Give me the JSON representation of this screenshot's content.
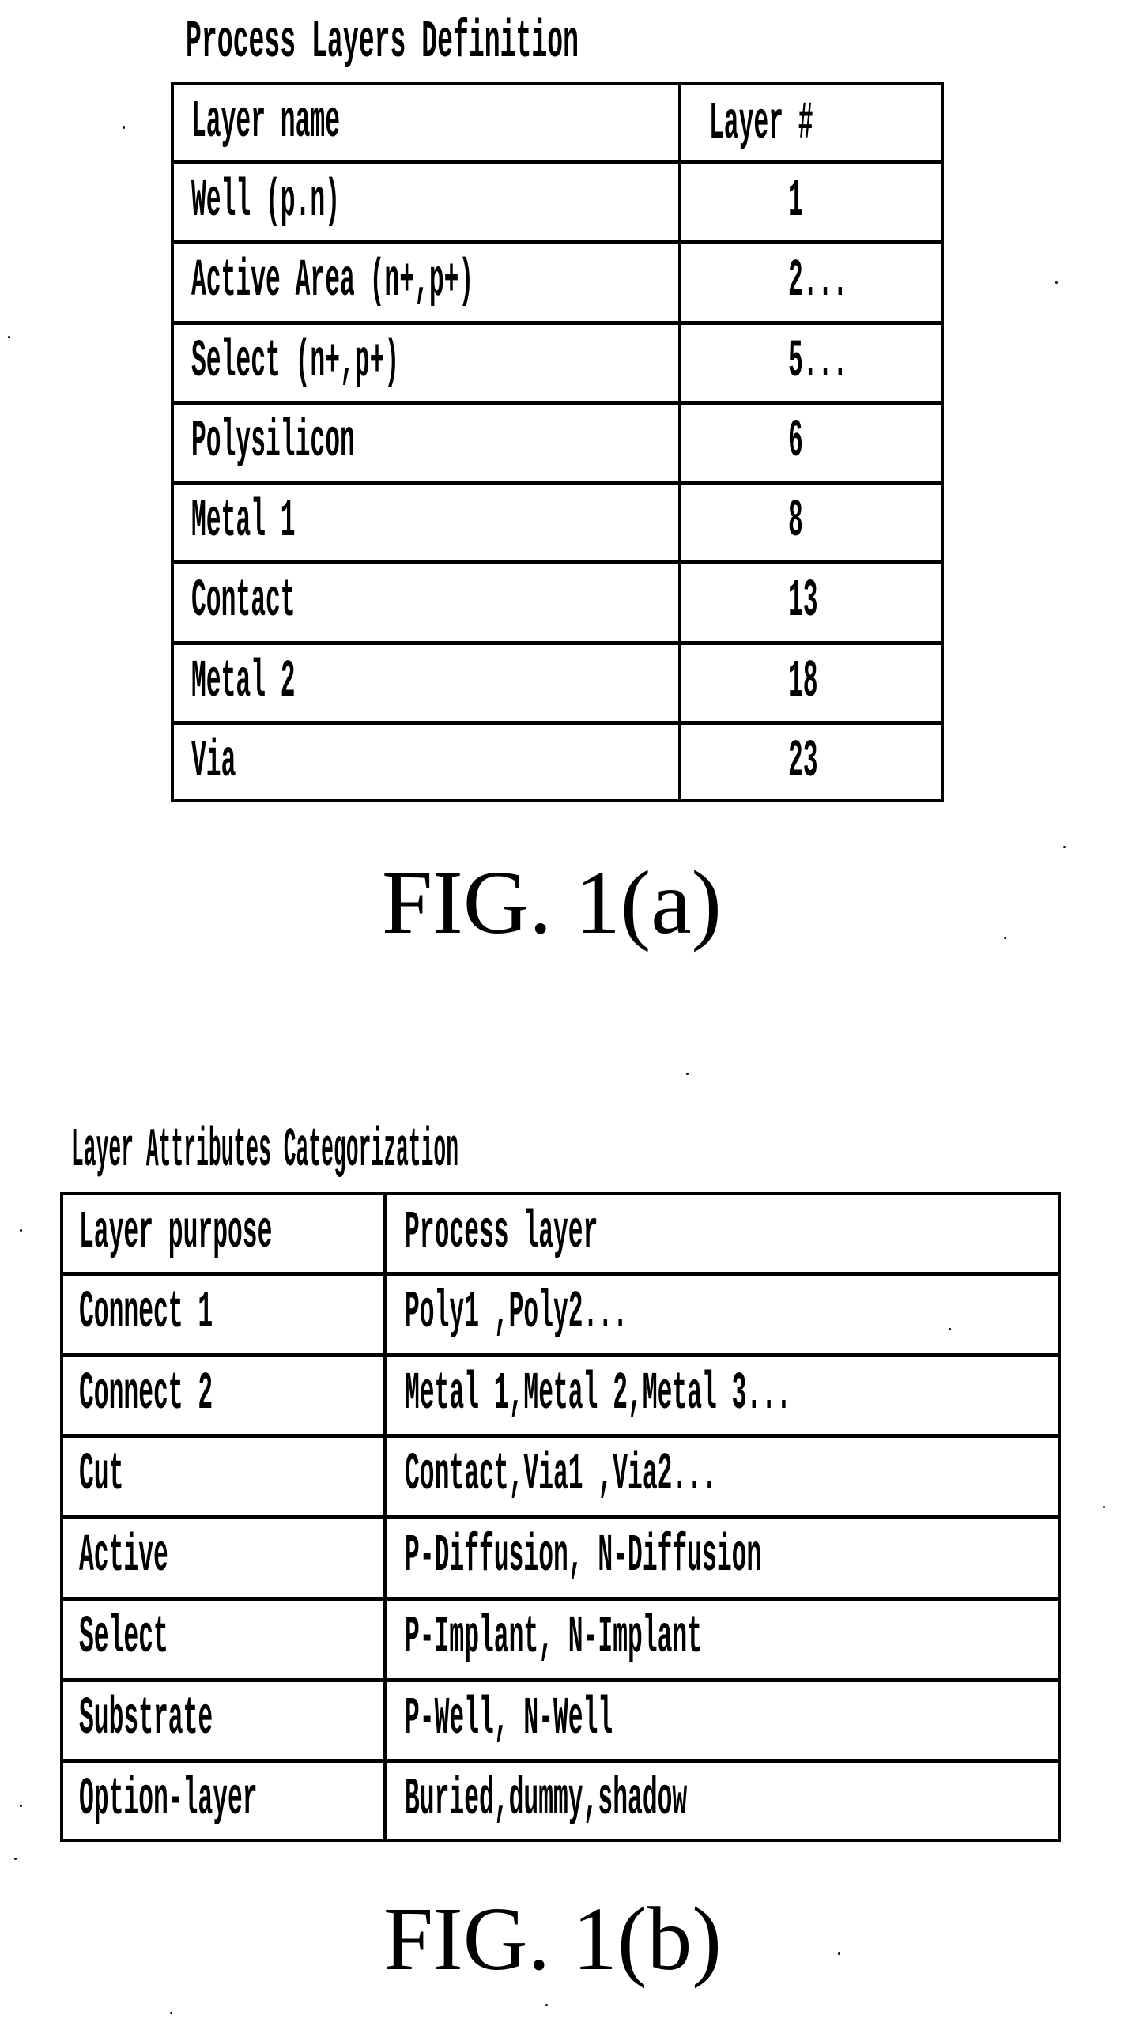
{
  "fig_a": {
    "title": "Process Layers Definition",
    "caption": "FIG. 1(a)",
    "headers": [
      "Layer name",
      "Layer #"
    ],
    "rows": [
      [
        "Well (p.n)",
        "1"
      ],
      [
        "Active Area (n+,p+)",
        "2..."
      ],
      [
        "Select (n+,p+)",
        "5..."
      ],
      [
        "Polysilicon",
        "6"
      ],
      [
        "Metal 1",
        "8"
      ],
      [
        "Contact",
        "13"
      ],
      [
        "Metal 2",
        "18"
      ],
      [
        "Via",
        "23"
      ]
    ]
  },
  "fig_b": {
    "title": "Layer Attributes Categorization",
    "caption": "FIG. 1(b)",
    "headers": [
      "Layer purpose",
      "Process layer"
    ],
    "rows": [
      [
        "Connect 1",
        "Poly1 ,Poly2..."
      ],
      [
        "Connect 2",
        "Metal 1,Metal 2,Metal 3..."
      ],
      [
        "Cut",
        "Contact,Via1 ,Via2..."
      ],
      [
        "Active",
        "P-Diffusion, N-Diffusion"
      ],
      [
        "Select",
        "P-Implant, N-Implant"
      ],
      [
        "Substrate",
        "P-Well, N-Well"
      ],
      [
        "Option-layer",
        "Buried,dummy,shadow"
      ]
    ]
  }
}
